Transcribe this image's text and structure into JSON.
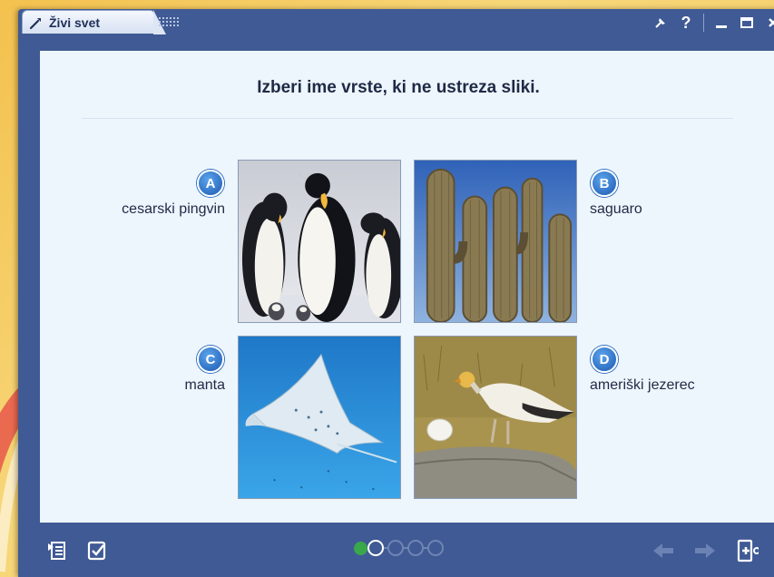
{
  "window": {
    "title": "Živi svet",
    "controls": [
      "pin-icon",
      "help-icon",
      "minimize-icon",
      "maximize-icon",
      "close-icon"
    ],
    "help_label": "?"
  },
  "quiz": {
    "question": "Izberi ime vrste, ki ne ustreza sliki.",
    "options": [
      {
        "letter": "A",
        "label": "cesarski pingvin",
        "image": "emperor-penguins"
      },
      {
        "letter": "B",
        "label": "saguaro",
        "image": "saguaro-cactus"
      },
      {
        "letter": "C",
        "label": "manta",
        "image": "manta-ray"
      },
      {
        "letter": "D",
        "label": "ameriški jezerec",
        "image": "vulture-with-egg"
      }
    ]
  },
  "progress": {
    "total": 5,
    "current": 2,
    "states": [
      "done",
      "current",
      "todo",
      "todo",
      "todo"
    ]
  },
  "colors": {
    "window_frame": "#3f5a94",
    "panel": "#edf5fd",
    "badge": "#2e6fc3",
    "progress_done": "#3aa84a",
    "background": "#f3c14e"
  },
  "toolbar": {
    "left_icons": [
      "list-icon",
      "check-edit-icon"
    ],
    "right_icons": [
      "arrow-left-icon",
      "arrow-right-icon",
      "exit-icon"
    ]
  }
}
